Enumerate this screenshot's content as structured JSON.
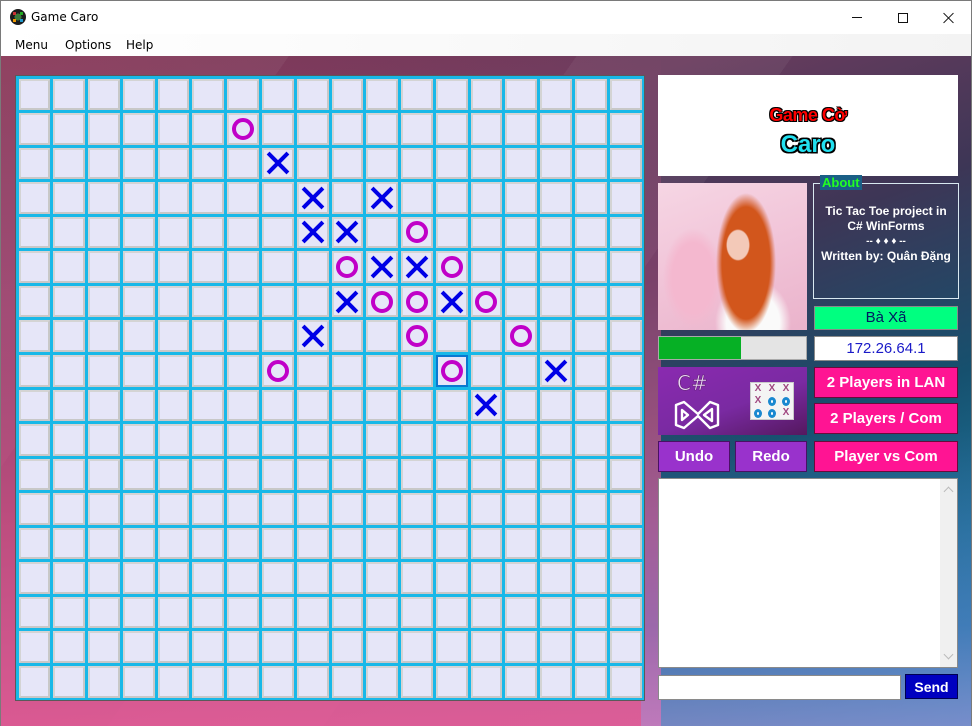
{
  "window": {
    "title": "Game Caro",
    "icon": "caro-app-icon",
    "controls": [
      "minimize",
      "maximize",
      "close"
    ]
  },
  "menubar": {
    "items": [
      "Menu",
      "Options",
      "Help"
    ]
  },
  "board": {
    "columns": 18,
    "rows": 18,
    "colors": {
      "x": "#0000e6",
      "o": "#c000c8",
      "grid": "#18b8e8",
      "cell": "#e6e6f8",
      "highlight": "#0a78d0"
    },
    "last_move": {
      "row": 8,
      "col": 12
    },
    "pieces": [
      {
        "row": 1,
        "col": 6,
        "mark": "O"
      },
      {
        "row": 2,
        "col": 7,
        "mark": "X"
      },
      {
        "row": 3,
        "col": 8,
        "mark": "X"
      },
      {
        "row": 3,
        "col": 10,
        "mark": "X"
      },
      {
        "row": 4,
        "col": 8,
        "mark": "X"
      },
      {
        "row": 4,
        "col": 9,
        "mark": "X"
      },
      {
        "row": 4,
        "col": 11,
        "mark": "O"
      },
      {
        "row": 5,
        "col": 9,
        "mark": "O"
      },
      {
        "row": 5,
        "col": 10,
        "mark": "X"
      },
      {
        "row": 5,
        "col": 11,
        "mark": "X"
      },
      {
        "row": 5,
        "col": 12,
        "mark": "O"
      },
      {
        "row": 6,
        "col": 9,
        "mark": "X"
      },
      {
        "row": 6,
        "col": 10,
        "mark": "O"
      },
      {
        "row": 6,
        "col": 11,
        "mark": "O"
      },
      {
        "row": 6,
        "col": 12,
        "mark": "X"
      },
      {
        "row": 6,
        "col": 13,
        "mark": "O"
      },
      {
        "row": 7,
        "col": 8,
        "mark": "X"
      },
      {
        "row": 7,
        "col": 11,
        "mark": "O"
      },
      {
        "row": 7,
        "col": 14,
        "mark": "O"
      },
      {
        "row": 8,
        "col": 7,
        "mark": "O"
      },
      {
        "row": 8,
        "col": 12,
        "mark": "O"
      },
      {
        "row": 8,
        "col": 15,
        "mark": "X"
      },
      {
        "row": 9,
        "col": 13,
        "mark": "X"
      }
    ]
  },
  "sidebar": {
    "title_line1": "Game Cờ",
    "title_line2": "Caro",
    "avatar": "player-avatar-photo",
    "about": {
      "legend": "About",
      "line1": "Tic Tac Toe project in",
      "line2": "C# WinForms",
      "line3": "-- ♦ ♦ ♦ --",
      "line4": "Written by: Quân Đặng"
    },
    "player_name": "Bà Xã",
    "ip_address": "172.26.64.1",
    "timer_progress_percent": 56,
    "logo": {
      "language": "C#",
      "mini_board": [
        "X",
        "X",
        "X",
        "X",
        "O",
        "O",
        "O",
        "O",
        "X"
      ]
    },
    "buttons": {
      "lan": "2 Players in LAN",
      "two_players_com": "2 Players / Com",
      "player_vs_com": "Player vs Com",
      "undo": "Undo",
      "redo": "Redo",
      "send": "Send"
    },
    "chat_log": "",
    "message_input": ""
  }
}
